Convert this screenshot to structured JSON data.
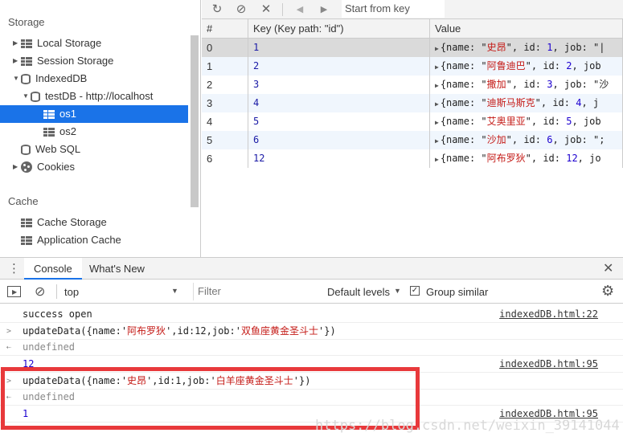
{
  "sidebar": {
    "storage_header": "Storage",
    "local_storage": "Local Storage",
    "session_storage": "Session Storage",
    "indexeddb": "IndexedDB",
    "db": "testDB - http://localhost",
    "store1": "os1",
    "store2": "os2",
    "web_sql": "Web SQL",
    "cookies": "Cookies",
    "cache_header": "Cache",
    "cache_storage": "Cache Storage",
    "app_cache": "Application Cache"
  },
  "toolbar": {
    "start_key_placeholder": "Start from key"
  },
  "grid": {
    "headers": [
      "#",
      "Key (Key path: \"id\")",
      "Value"
    ],
    "rows": [
      {
        "idx": "0",
        "key": "1",
        "name": "史昂",
        "id": "1",
        "tail": ", job: \"|"
      },
      {
        "idx": "1",
        "key": "2",
        "name": "阿鲁迪巴",
        "id": "2",
        "tail": ", job"
      },
      {
        "idx": "2",
        "key": "3",
        "name": "撒加",
        "id": "3",
        "tail": ", job: \"沙"
      },
      {
        "idx": "3",
        "key": "4",
        "name": "迪斯马斯克",
        "id": "4",
        "tail": ", j"
      },
      {
        "idx": "4",
        "key": "5",
        "name": "艾奥里亚",
        "id": "5",
        "tail": ", job"
      },
      {
        "idx": "5",
        "key": "6",
        "name": "沙加",
        "id": "6",
        "tail": ", job: \";"
      },
      {
        "idx": "6",
        "key": "12",
        "name": "阿布罗狄",
        "id": "12",
        "tail": ", jo"
      }
    ]
  },
  "drawer": {
    "tab_console": "Console",
    "tab_whats_new": "What's New"
  },
  "console_toolbar": {
    "context": "top",
    "filter_placeholder": "Filter",
    "levels": "Default levels",
    "group_similar": "Group similar"
  },
  "logs": {
    "l1": "success open",
    "l1_src": "indexedDB.html:22",
    "l2_pre": "updateData({name:'",
    "l2_name": "阿布罗狄",
    "l2_mid": "',id:12,job:'",
    "l2_job": "双鱼座黄金圣斗士",
    "l2_end": "'})",
    "l3": "undefined",
    "l4": "12",
    "l4_src": "indexedDB.html:95",
    "l5_pre": "updateData({name:'",
    "l5_name": "史昂",
    "l5_mid": "',id:1,job:'",
    "l5_job": "白羊座黄金圣斗士",
    "l5_end": "'})",
    "l6": "undefined",
    "l7": "1",
    "l7_src": "indexedDB.html:95"
  },
  "watermark": "https://blog.csdn.net/weixin_39141044",
  "colors": {
    "selection": "#1a73e8",
    "highlight_box": "#e8393b",
    "string": "#c41a16",
    "number": "#1c00cf"
  }
}
